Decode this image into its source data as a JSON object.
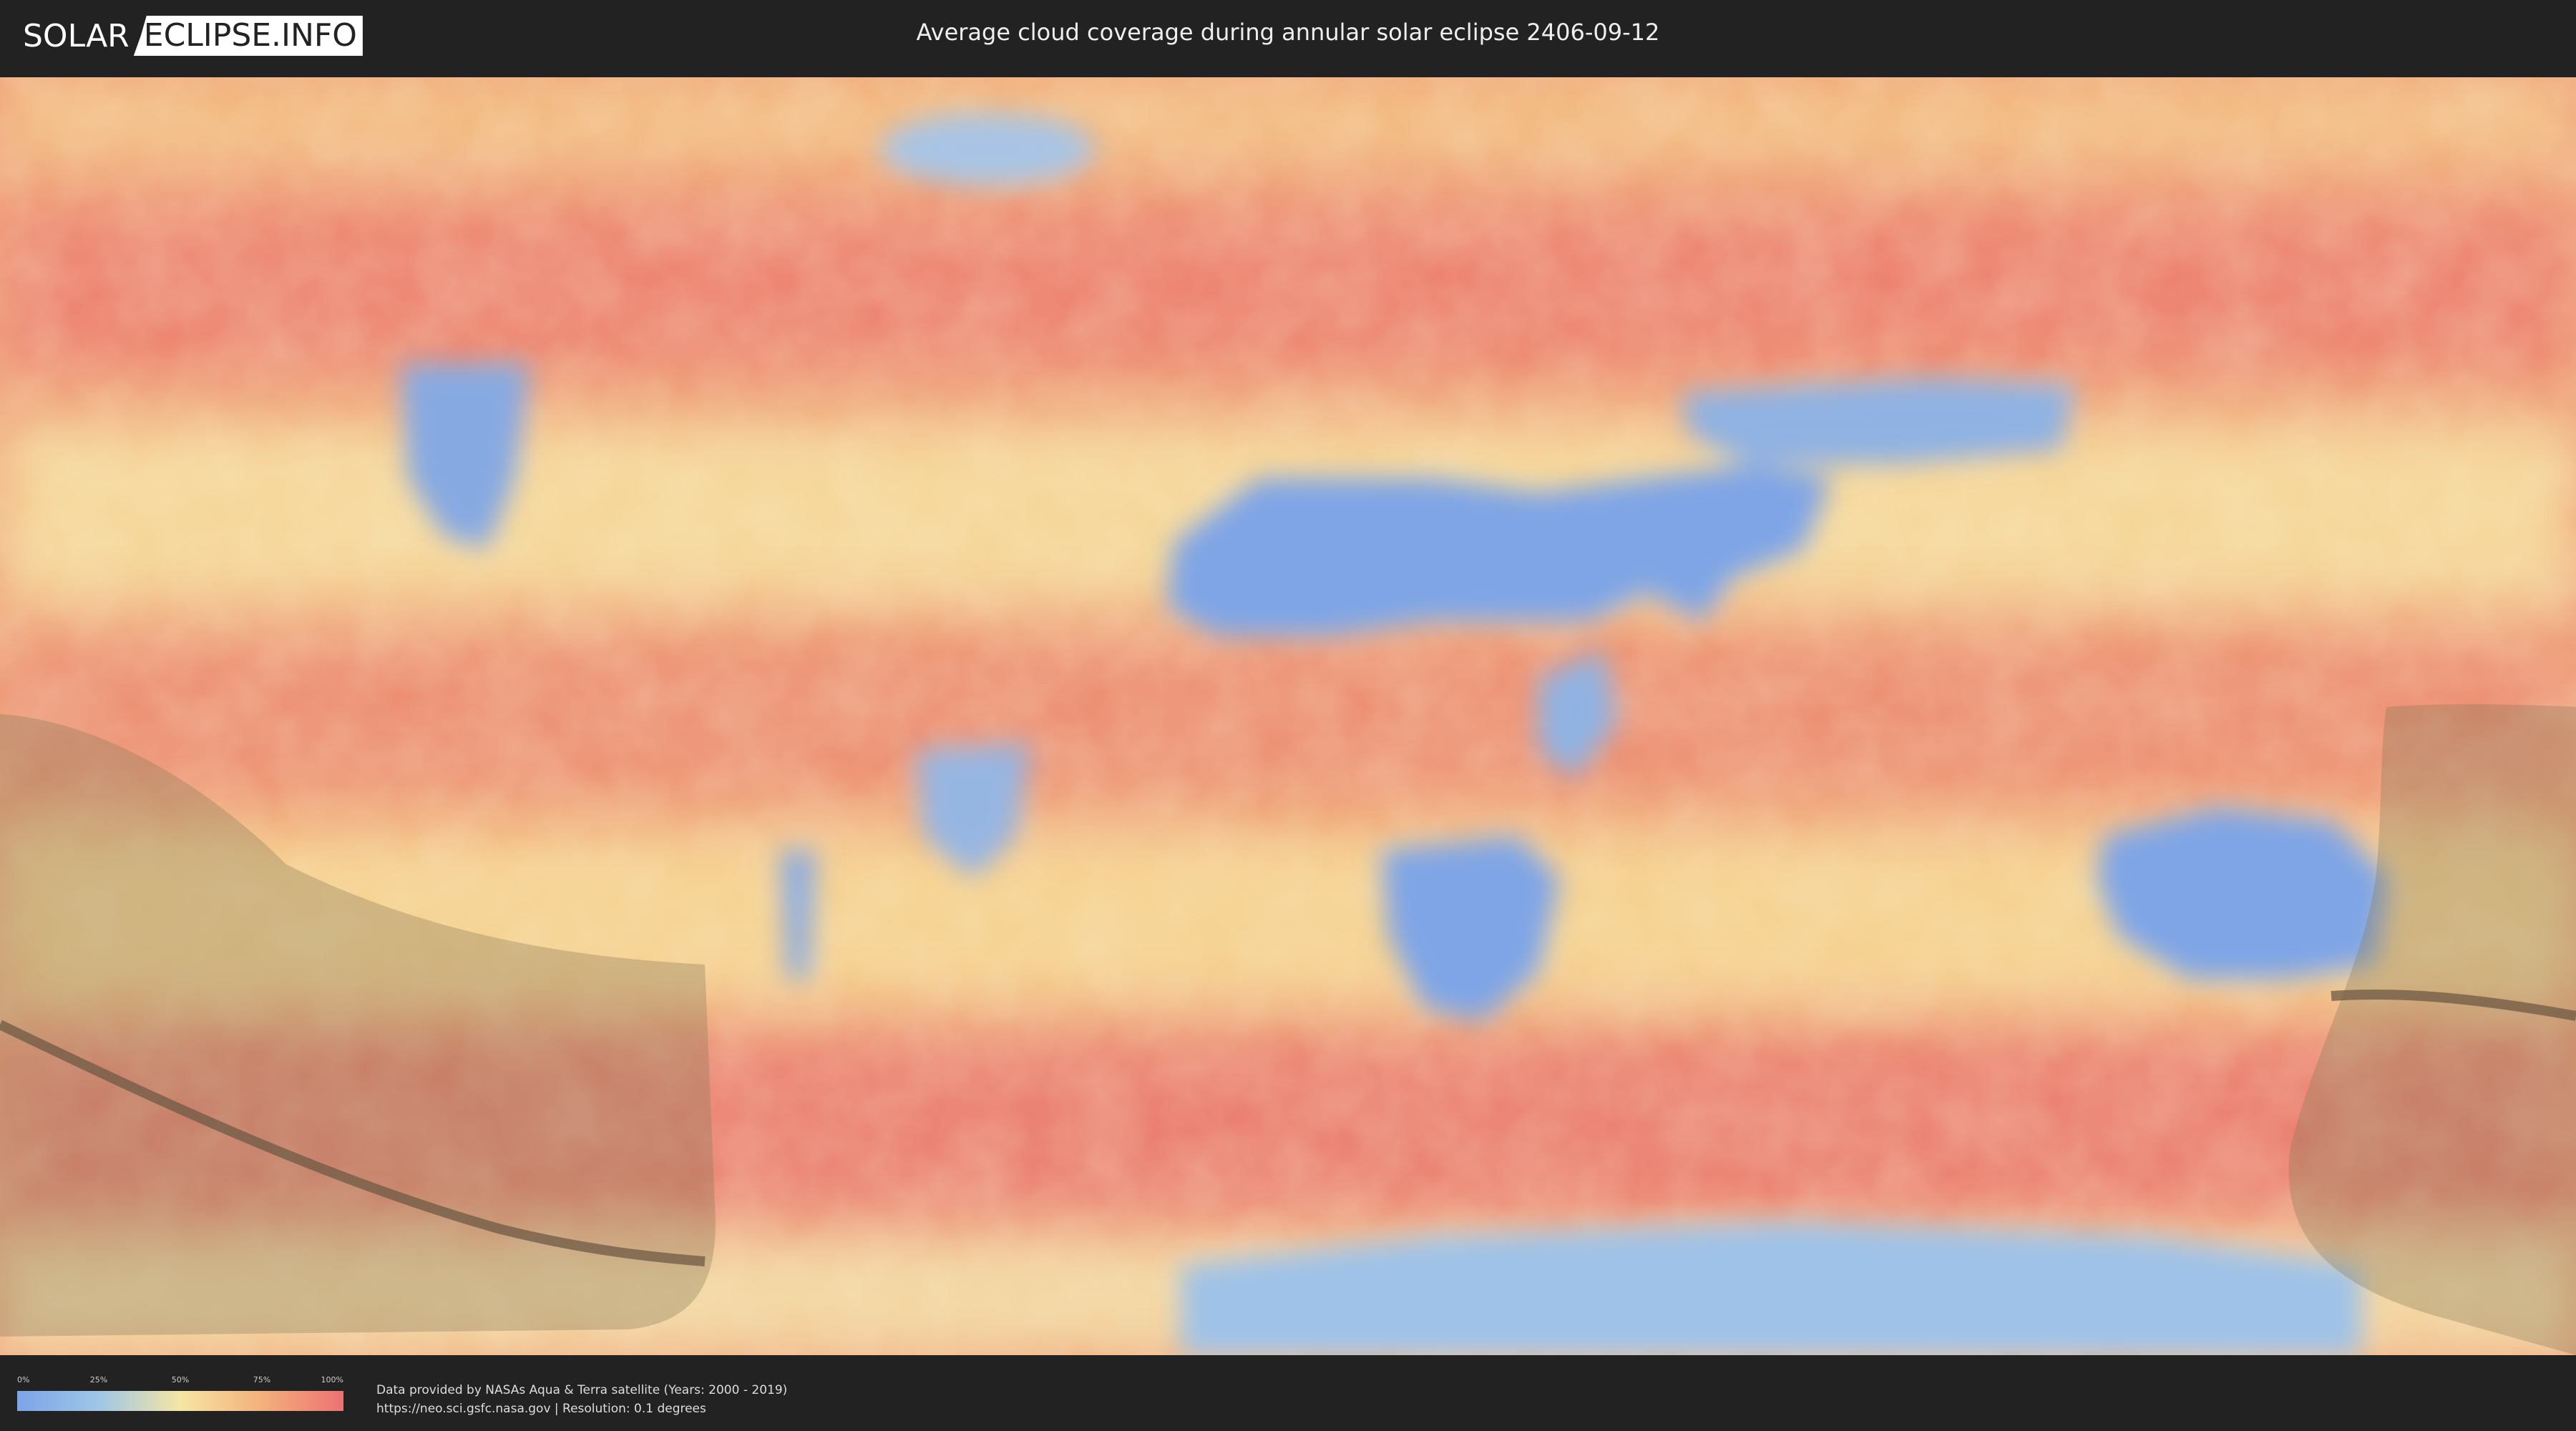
{
  "header": {
    "logo_left": "SOLAR",
    "logo_right": "ECLIPSE.INFO",
    "title": "Average cloud coverage during annular solar eclipse 2406-09-12"
  },
  "legend": {
    "ticks": [
      "0%",
      "25%",
      "50%",
      "75%",
      "100%"
    ],
    "colors": [
      "#7ca4e8",
      "#9fc6e6",
      "#f5e6a4",
      "#f4b07c",
      "#ec7272"
    ]
  },
  "credits": {
    "line1": "Data provided by NASAs Aqua & Terra satellite (Years: 2000 - 2019)",
    "line2": "https://neo.sci.gsfc.nasa.gov | Resolution: 0.1 degrees"
  },
  "colors": {
    "clear": "#7ca4e8",
    "cloudy": "#ec7272",
    "mid": "#f5e6a4",
    "shadow": "#8a7a5a"
  }
}
